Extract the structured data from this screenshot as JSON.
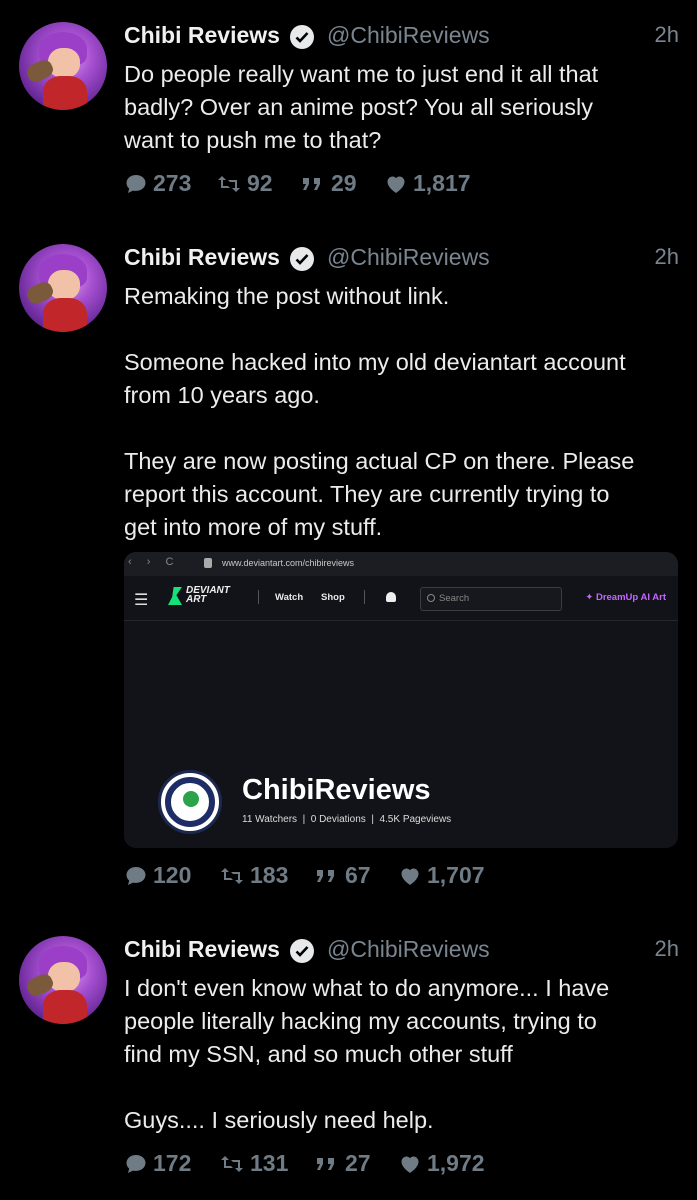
{
  "tweets": [
    {
      "author": "Chibi Reviews",
      "handle": "@ChibiReviews",
      "time": "2h",
      "text": "Do people really want me to just end it all that\nbadly? Over an anime post? You all seriously\nwant to push me to that?",
      "replies": "273",
      "retweets": "92",
      "quotes": "29",
      "likes": "1,817"
    },
    {
      "author": "Chibi Reviews",
      "handle": "@ChibiReviews",
      "time": "2h",
      "text": "Remaking the post without link.\n\nSomeone hacked into my old deviantart account\nfrom 10 years ago.\n\nThey are now posting actual CP on there. Please\nreport this account. They are currently trying to\nget into more of my stuff.",
      "replies": "120",
      "retweets": "183",
      "quotes": "67",
      "likes": "1,707",
      "media": {
        "nav": "‹ › C",
        "url": "www.deviantart.com/chibireviews",
        "menu_icon": "☰",
        "logo_text": "DEVIANT\nART",
        "nav_watch": "Watch",
        "nav_shop": "Shop",
        "search_placeholder": "Search",
        "dreamup": "✦ DreamUp AI Art",
        "profile_name": "ChibiReviews",
        "profile_stats": "11 Watchers  |  0 Deviations  |  4.5K Pageviews"
      }
    },
    {
      "author": "Chibi Reviews",
      "handle": "@ChibiReviews",
      "time": "2h",
      "text": "I don't even know what to do anymore... I have\npeople literally hacking my accounts, trying to\nfind my SSN, and so much other stuff\n\nGuys.... I seriously need help.",
      "replies": "172",
      "retweets": "131",
      "quotes": "27",
      "likes": "1,972"
    }
  ],
  "colors": {
    "background": "#000000",
    "text": "#ececec",
    "muted": "#7a8590",
    "dreamup": "#c566ff"
  }
}
